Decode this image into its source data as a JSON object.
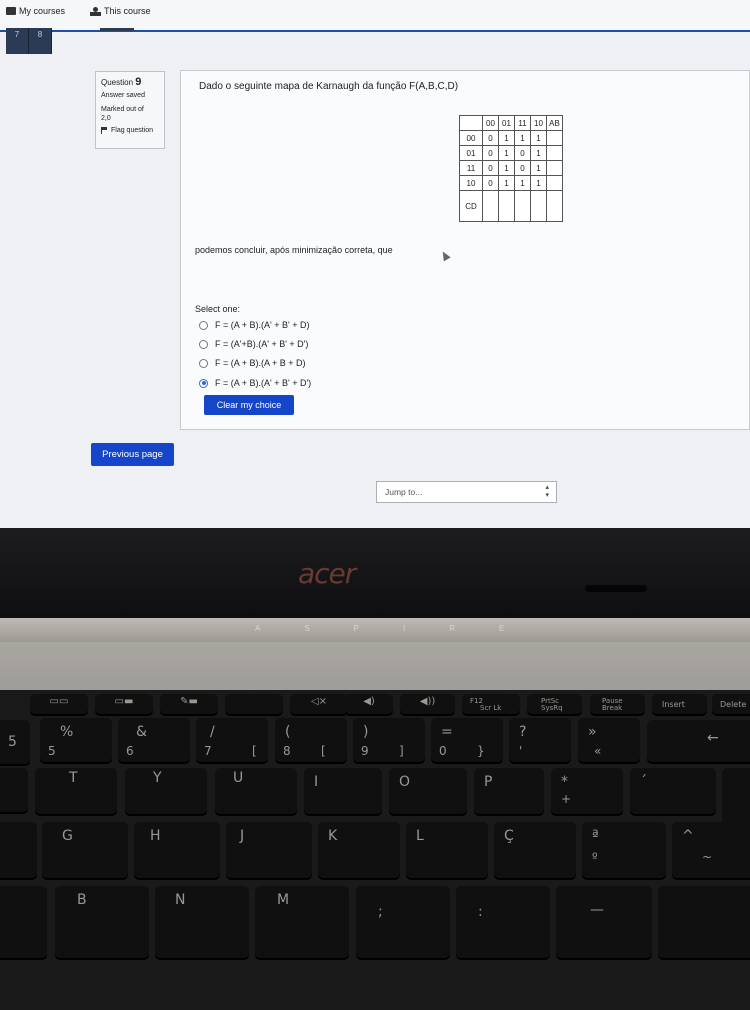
{
  "topbar": {
    "my_courses": "My courses",
    "this_course": "This course"
  },
  "qnav": [
    "7",
    "8"
  ],
  "question_info": {
    "label": "Question",
    "number": "9",
    "status": "Answer saved",
    "marked": "Marked out of",
    "mark_value": "2,0",
    "flag": "Flag question"
  },
  "question": {
    "text": "Dado o seguinte mapa de Karnaugh da função F(A,B,C,D)",
    "kmap": {
      "corner_label": "AB",
      "col_headers": [
        "00",
        "01",
        "11",
        "10"
      ],
      "rows": [
        {
          "label": "00",
          "cells": [
            "0",
            "1",
            "1",
            "1"
          ]
        },
        {
          "label": "01",
          "cells": [
            "0",
            "1",
            "0",
            "1"
          ]
        },
        {
          "label": "11",
          "cells": [
            "0",
            "1",
            "0",
            "1"
          ]
        },
        {
          "label": "10",
          "cells": [
            "0",
            "1",
            "1",
            "1"
          ]
        }
      ],
      "row_axis_label": "CD"
    },
    "conclusion": "podemos concluir, após minimização correta, que",
    "select_one": "Select one:",
    "options": [
      {
        "text": "F = (A + B).(A' + B' + D)",
        "selected": false
      },
      {
        "text": "F = (A'+B).(A' + B' + D')",
        "selected": false
      },
      {
        "text": "F = (A + B).(A + B + D)",
        "selected": false
      },
      {
        "text": "F = (A + B).(A' + B' + D')",
        "selected": true
      }
    ],
    "clear_button": "Clear my choice"
  },
  "navigation": {
    "previous_button": "Previous page",
    "jump_placeholder": "Jump to..."
  },
  "laptop": {
    "brand": "acer",
    "series": "ASPIRE",
    "keys": {
      "f12_top": "F12",
      "f12_bottom": "Scr Lk",
      "prtsc_top": "PrtSc",
      "prtsc_bottom": "SysRq",
      "pause_top": "Pause",
      "pause_bottom": "Break",
      "insert": "Insert",
      "delete": "Delete",
      "k5_top": "%",
      "k5_bottom": "5",
      "k6_top": "&",
      "k6_bottom": "6",
      "k7_top": "/",
      "k7_bottom": "7",
      "k7_alt": "[",
      "k8_top": "(",
      "k8_bottom": "8",
      "k8_alt": "[",
      "k9_top": ")",
      "k9_bottom": "9",
      "k9_alt": "]",
      "k0_top": "=",
      "k0_bottom": "0",
      "k0_alt": "}",
      "quote_top": "?",
      "quote_bottom": "'",
      "guil_top": "»",
      "guil_bottom": "«",
      "backspace": "←",
      "t": "T",
      "y": "Y",
      "u": "U",
      "i": "I",
      "o": "O",
      "p": "P",
      "plus_top": "*",
      "plus_bottom": "+",
      "acute": "´",
      "g": "G",
      "h": "H",
      "j": "J",
      "k": "K",
      "l": "L",
      "cedilla": "Ç",
      "ord_top": "ª",
      "ord_bottom": "º",
      "tilde_top": "^",
      "tilde_bottom": "~",
      "b": "B",
      "n": "N",
      "m": "M"
    }
  }
}
